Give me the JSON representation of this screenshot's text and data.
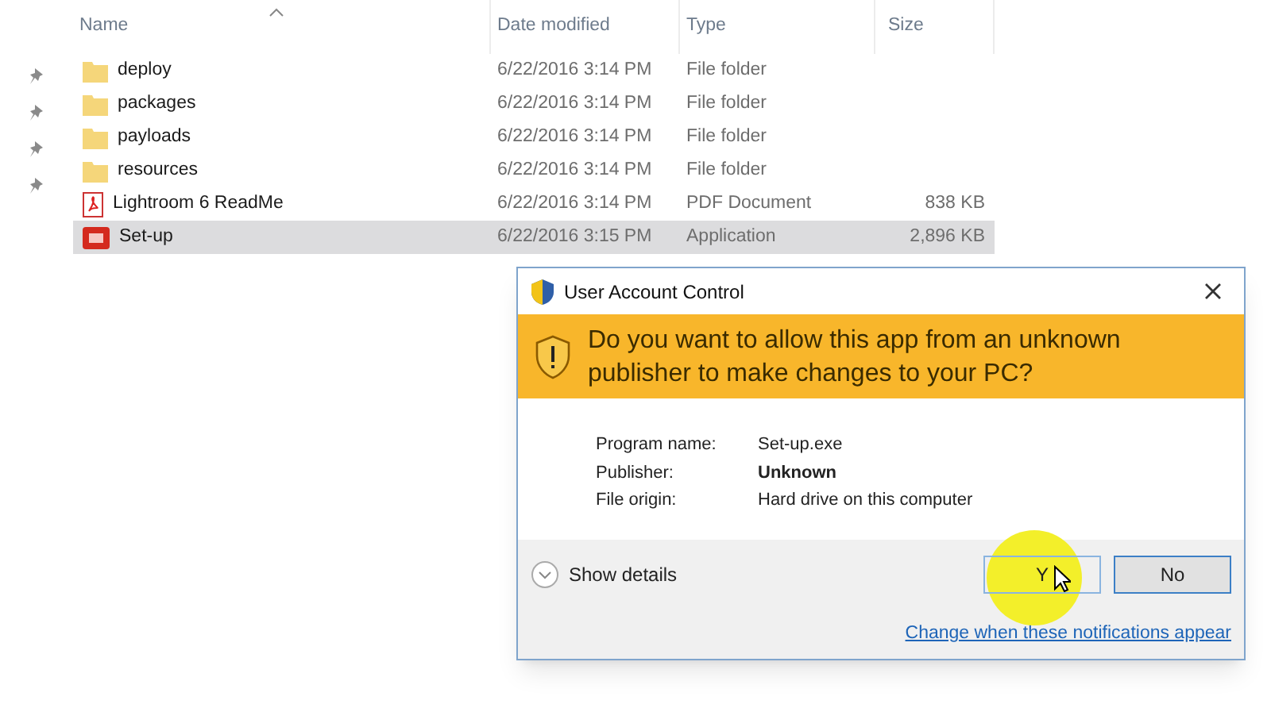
{
  "columns": [
    {
      "label": "Name",
      "sorted": true
    },
    {
      "label": "Date modified",
      "sorted": false
    },
    {
      "label": "Type",
      "sorted": false
    },
    {
      "label": "Size",
      "sorted": false
    }
  ],
  "files": [
    {
      "name": "deploy",
      "kind": "folder",
      "date": "6/22/2016 3:14 PM",
      "type": "File folder",
      "selected": false
    },
    {
      "name": "packages",
      "kind": "folder",
      "date": "6/22/2016 3:14 PM",
      "type": "File folder",
      "selected": false
    },
    {
      "name": "payloads",
      "kind": "folder",
      "date": "6/22/2016 3:14 PM",
      "type": "File folder",
      "selected": false
    },
    {
      "name": "resources",
      "kind": "folder",
      "date": "6/22/2016 3:14 PM",
      "type": "File folder",
      "selected": false
    },
    {
      "name": "Lightroom 6 ReadMe",
      "kind": "pdf",
      "date": "6/22/2016 3:14 PM",
      "type": "PDF Document",
      "size": "838 KB",
      "selected": false
    },
    {
      "name": "Set-up",
      "kind": "app",
      "date": "6/22/2016 3:15 PM",
      "type": "Application",
      "size": "2,896 KB",
      "selected": true
    }
  ],
  "dialog": {
    "title": "User Account Control",
    "question": "Do you want to allow this app from an unknown publisher to make changes to your PC?",
    "details": [
      {
        "label": "Program name:",
        "value": "Set-up.exe",
        "bold": false
      },
      {
        "label": "Publisher:",
        "value": "Unknown",
        "bold": true
      },
      {
        "label": "File origin:",
        "value": "Hard drive on this computer",
        "bold": false
      }
    ],
    "show_details": "Show details",
    "buttons": [
      {
        "label": "Y",
        "highlighted": true
      },
      {
        "label": "No",
        "highlighted": false
      }
    ],
    "link": "Change when these notifications appear"
  }
}
